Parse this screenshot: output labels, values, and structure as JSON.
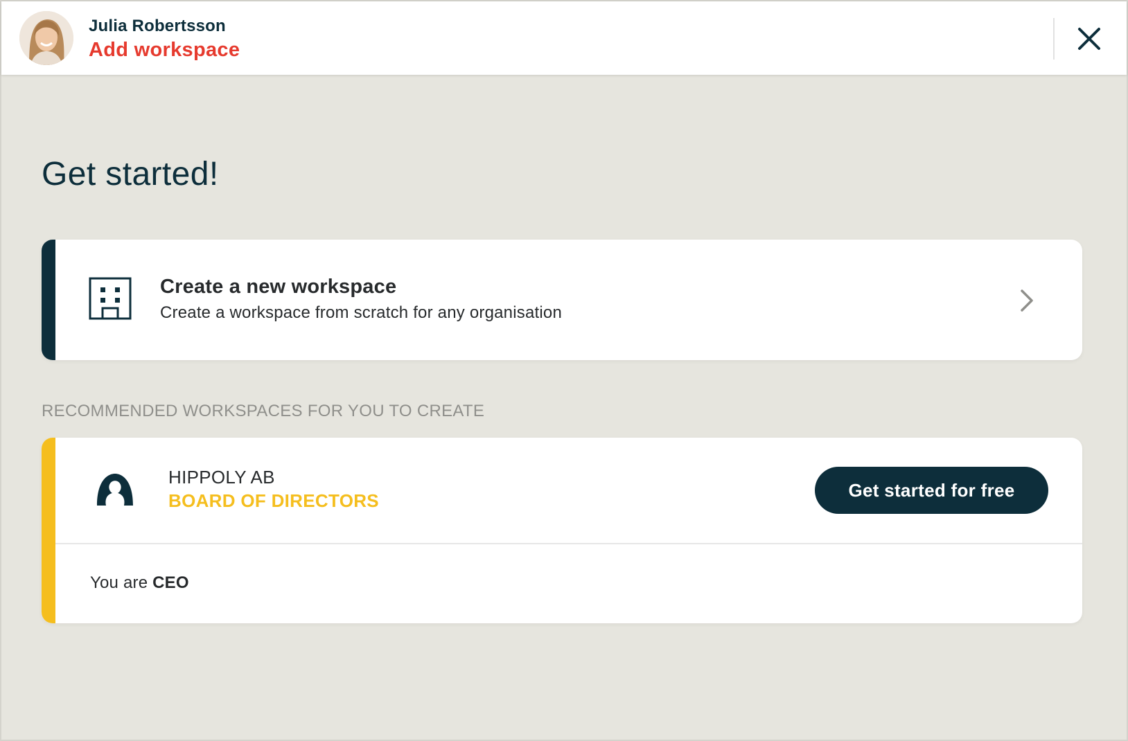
{
  "header": {
    "user_name": "Julia Robertsson",
    "title": "Add workspace",
    "avatar_icon": "user-avatar-photo",
    "close_icon": "close-x-icon"
  },
  "main": {
    "title": "Get started!",
    "create_card": {
      "title": "Create a new workspace",
      "subtitle": "Create a workspace from scratch for any organisation",
      "icon": "building-icon",
      "action_icon": "chevron-right-icon"
    },
    "recommended_label": "RECOMMENDED WORKSPACES FOR YOU TO CREATE",
    "recommended": [
      {
        "org_name": "HIPPOLY AB",
        "workspace_type": "BOARD OF DIRECTORS",
        "button_label": "Get started for free",
        "role_prefix": "You are",
        "role": "CEO",
        "icon": "org-avatar-icon"
      }
    ]
  },
  "colors": {
    "primary": "#0d2e3b",
    "header_accent": "#e63a2e",
    "recommended_accent": "#f5be1e",
    "background": "#e6e5de",
    "card": "#ffffff",
    "muted_text": "#8f8f8b"
  }
}
